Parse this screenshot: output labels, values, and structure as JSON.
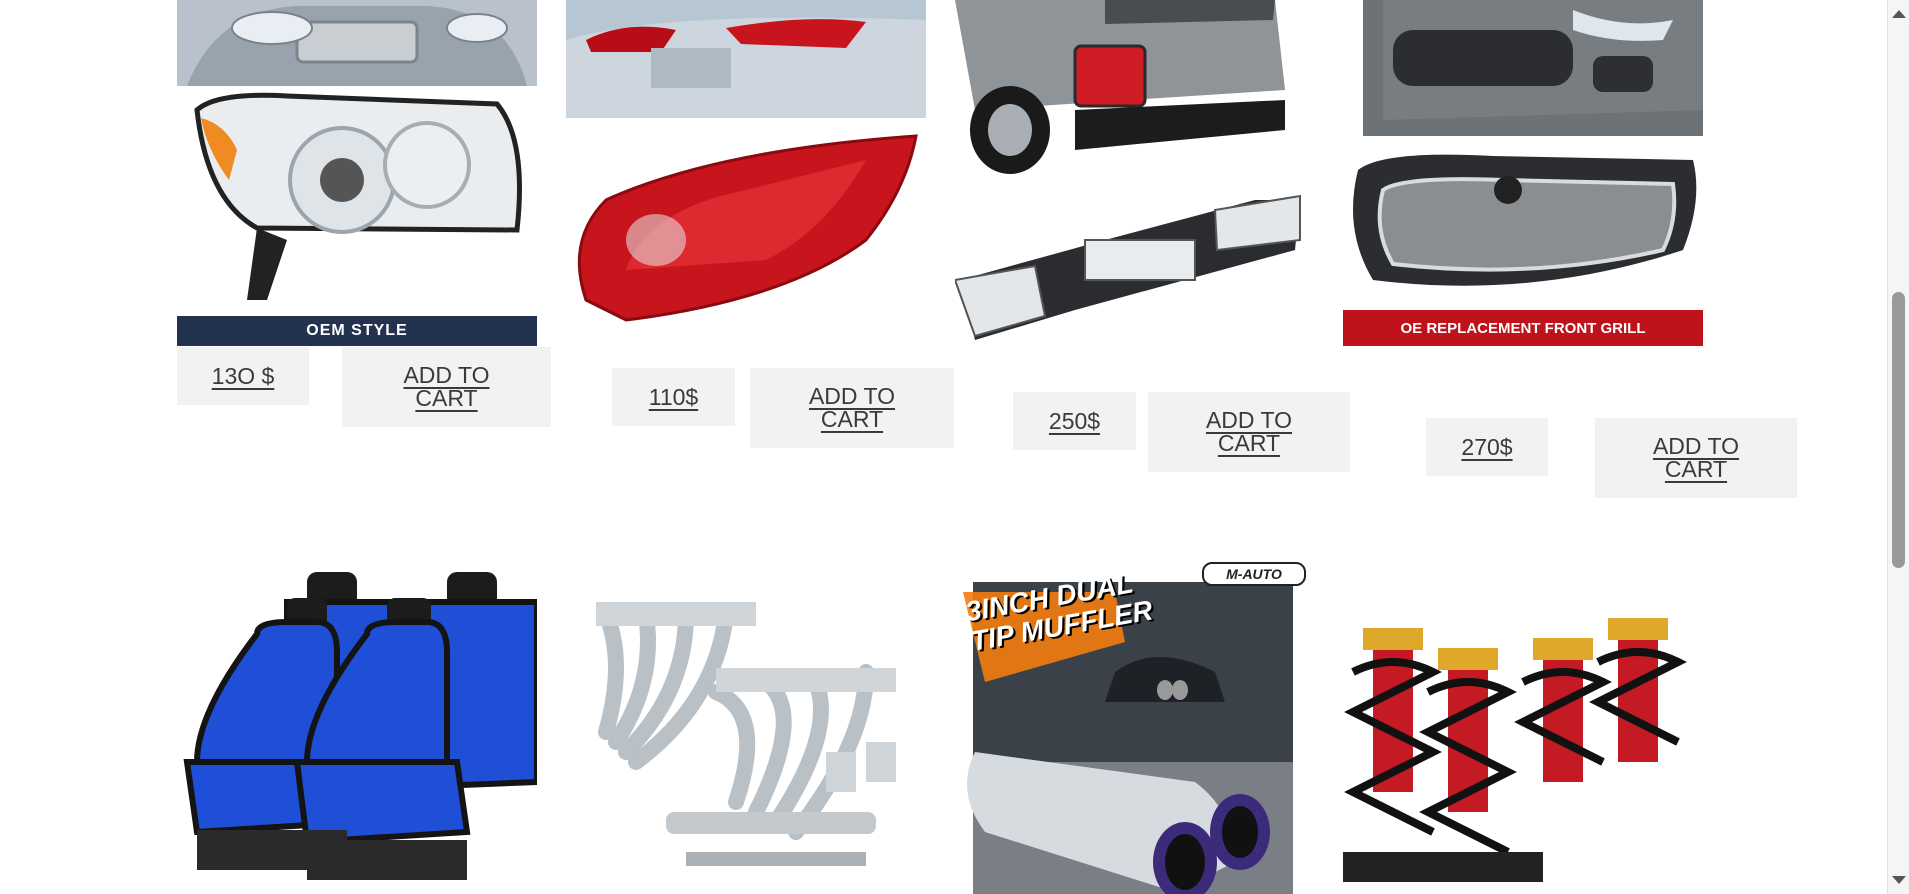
{
  "products_row1": [
    {
      "price": "13O $",
      "cta": "ADD TO CART",
      "banner": "OEM STYLE"
    },
    {
      "price": "110$",
      "cta": "ADD TO CART"
    },
    {
      "price": "250$",
      "cta": "ADD TO CART"
    },
    {
      "price": "270$",
      "cta": "ADD TO CART",
      "banner": "OE REPLACEMENT FRONT GRILL"
    }
  ],
  "promo": {
    "brand": "M-AUTO",
    "headline": "3INCH DUAL TIP MUFFLER"
  },
  "colors": {
    "button_bg": "#f0f3f1",
    "tail_red": "#c8141c",
    "seat_blue": "#1f4fd6",
    "banner_red": "#c0121a",
    "banner_navy": "#23324f"
  }
}
